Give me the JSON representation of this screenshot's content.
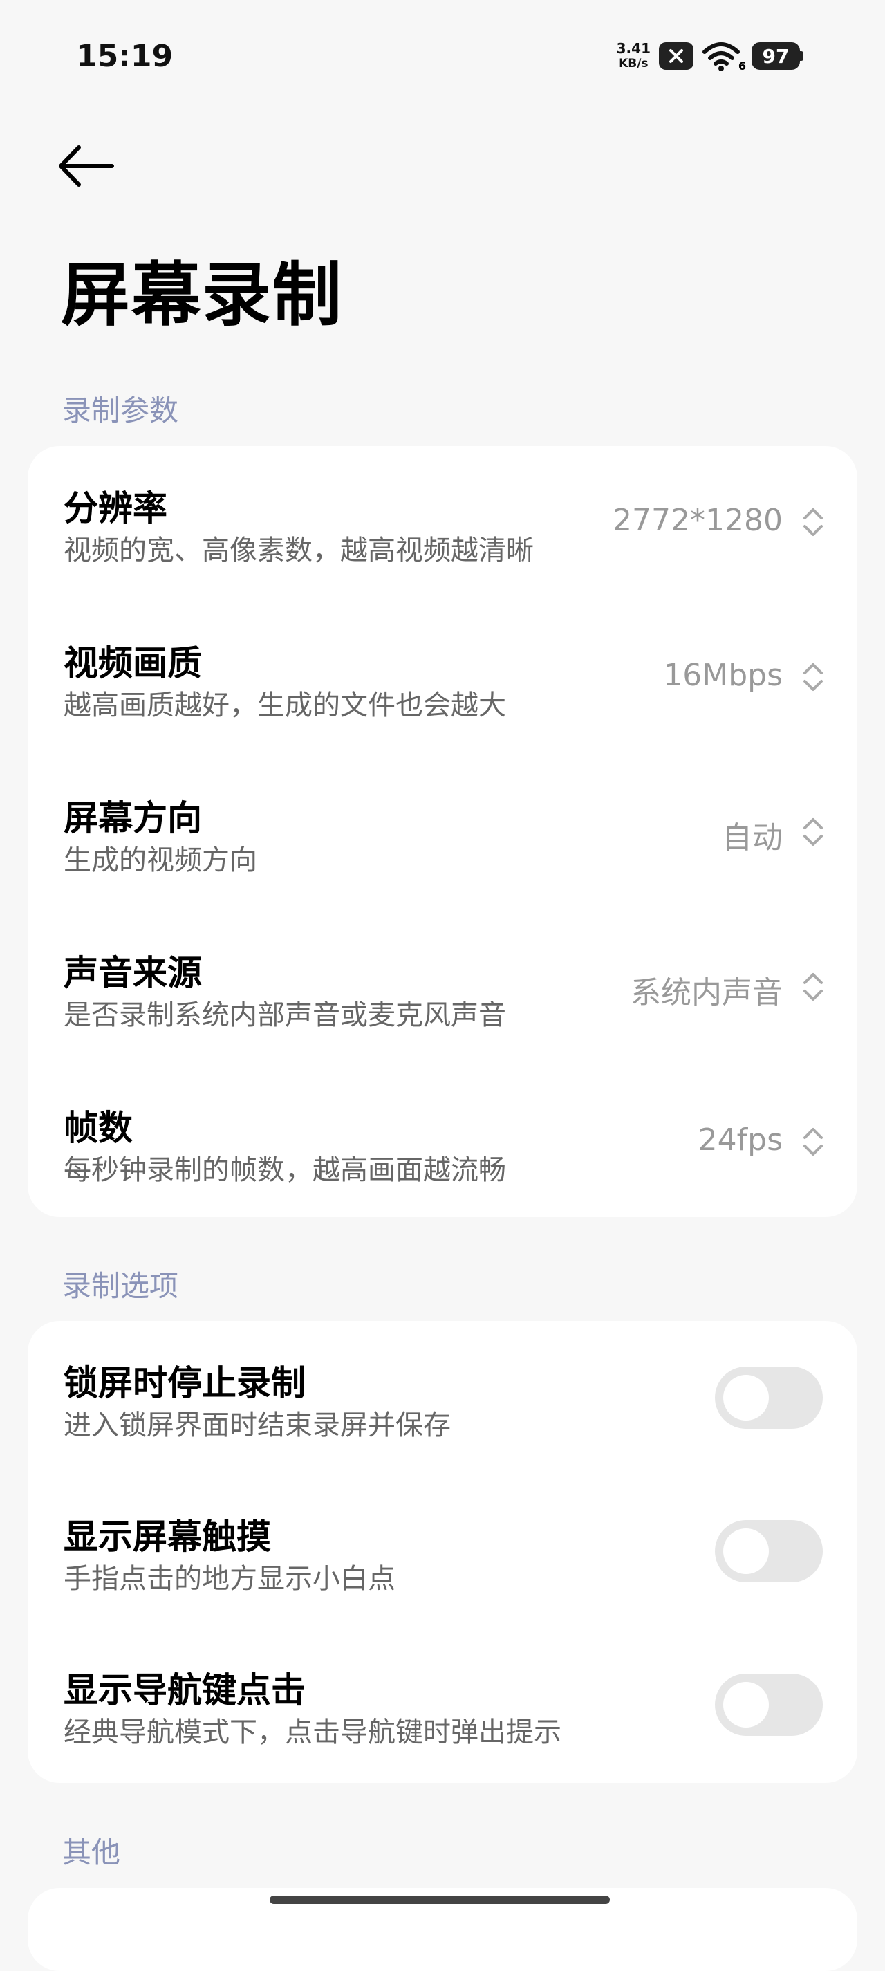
{
  "status_bar": {
    "time": "15:19",
    "net_speed_value": "3.41",
    "net_speed_unit": "KB/s",
    "wifi_generation": "6",
    "battery": "97"
  },
  "header": {
    "title": "屏幕录制"
  },
  "sections": {
    "recording_params": {
      "header": "录制参数",
      "rows": [
        {
          "title": "分辨率",
          "desc": "视频的宽、高像素数，越高视频越清晰",
          "value": "2772*1280"
        },
        {
          "title": "视频画质",
          "desc": "越高画质越好，生成的文件也会越大",
          "value": "16Mbps"
        },
        {
          "title": "屏幕方向",
          "desc": "生成的视频方向",
          "value": "自动"
        },
        {
          "title": "声音来源",
          "desc": "是否录制系统内部声音或麦克风声音",
          "value": "系统内声音"
        },
        {
          "title": "帧数",
          "desc": "每秒钟录制的帧数，越高画面越流畅",
          "value": "24fps"
        }
      ]
    },
    "recording_options": {
      "header": "录制选项",
      "rows": [
        {
          "title": "锁屏时停止录制",
          "desc": "进入锁屏界面时结束录屏并保存",
          "enabled": false
        },
        {
          "title": "显示屏幕触摸",
          "desc": "手指点击的地方显示小白点",
          "enabled": false
        },
        {
          "title": "显示导航键点击",
          "desc": "经典导航模式下，点击导航键时弹出提示",
          "enabled": false
        }
      ]
    },
    "other": {
      "header": "其他"
    }
  },
  "icons": {
    "back": "arrow-left-icon",
    "selector": "chevron-up-down-icon",
    "wifi": "wifi-icon",
    "vpn": "x-box-icon"
  }
}
